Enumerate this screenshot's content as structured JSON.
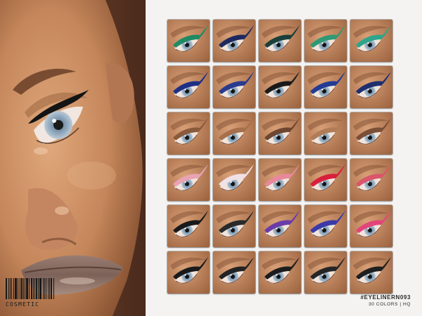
{
  "product": {
    "title": "#EYELINERN093",
    "subtitle": "30 COLORS | HQ"
  },
  "brand": {
    "name": "COSMETIC"
  },
  "swatches": [
    {
      "row": 1,
      "liner_color": "#1f8a63",
      "icon": "eye-icon"
    },
    {
      "row": 1,
      "liner_color": "#1e2a5e",
      "icon": "eye-icon"
    },
    {
      "row": 1,
      "liner_color": "#1b3f3a",
      "icon": "eye-icon"
    },
    {
      "row": 1,
      "liner_color": "#2e9a74",
      "icon": "eye-icon"
    },
    {
      "row": 1,
      "liner_color": "#2ea58a",
      "icon": "eye-icon"
    },
    {
      "row": 2,
      "liner_color": "#1f2f86",
      "icon": "eye-icon"
    },
    {
      "row": 2,
      "liner_color": "#2a3a8e",
      "icon": "eye-icon"
    },
    {
      "row": 2,
      "liner_color": "#1a1a1a",
      "icon": "eye-icon"
    },
    {
      "row": 2,
      "liner_color": "#233b93",
      "icon": "eye-icon"
    },
    {
      "row": 2,
      "liner_color": "#1e2f6f",
      "icon": "eye-icon"
    },
    {
      "row": 3,
      "liner_color": "#8a5a3c",
      "icon": "eye-icon"
    },
    {
      "row": 3,
      "liner_color": "#a5704b",
      "icon": "eye-icon"
    },
    {
      "row": 3,
      "liner_color": "#6e4630",
      "icon": "eye-icon"
    },
    {
      "row": 3,
      "liner_color": "#b07c58",
      "icon": "eye-icon"
    },
    {
      "row": 3,
      "liner_color": "#7a4f36",
      "icon": "eye-icon"
    },
    {
      "row": 4,
      "liner_color": "#e8a3b3",
      "icon": "eye-icon"
    },
    {
      "row": 4,
      "liner_color": "#f0e1e6",
      "icon": "eye-icon"
    },
    {
      "row": 4,
      "liner_color": "#e8889a",
      "icon": "eye-icon"
    },
    {
      "row": 4,
      "liner_color": "#d81f3c",
      "icon": "eye-icon"
    },
    {
      "row": 4,
      "liner_color": "#d9566b",
      "icon": "eye-icon"
    },
    {
      "row": 5,
      "liner_color": "#1a1a1a",
      "icon": "eye-icon"
    },
    {
      "row": 5,
      "liner_color": "#2a2a2a",
      "icon": "eye-icon"
    },
    {
      "row": 5,
      "liner_color": "#6a3ca8",
      "icon": "eye-icon"
    },
    {
      "row": 5,
      "liner_color": "#3a3aa8",
      "icon": "eye-icon"
    },
    {
      "row": 5,
      "liner_color": "#e2457a",
      "icon": "eye-icon"
    },
    {
      "row": 6,
      "liner_color": "#1a1a1a",
      "icon": "eye-icon"
    },
    {
      "row": 6,
      "liner_color": "#222222",
      "icon": "eye-icon"
    },
    {
      "row": 6,
      "liner_color": "#1c1c1c",
      "icon": "eye-icon"
    },
    {
      "row": 6,
      "liner_color": "#262626",
      "icon": "eye-icon"
    },
    {
      "row": 6,
      "liner_color": "#1f1f1f",
      "icon": "eye-icon"
    }
  ],
  "colors": {
    "background": "#f4f3f2",
    "skin": "#c78a5e",
    "iris": "#9fb4c8",
    "lip": "#8a6e64"
  }
}
